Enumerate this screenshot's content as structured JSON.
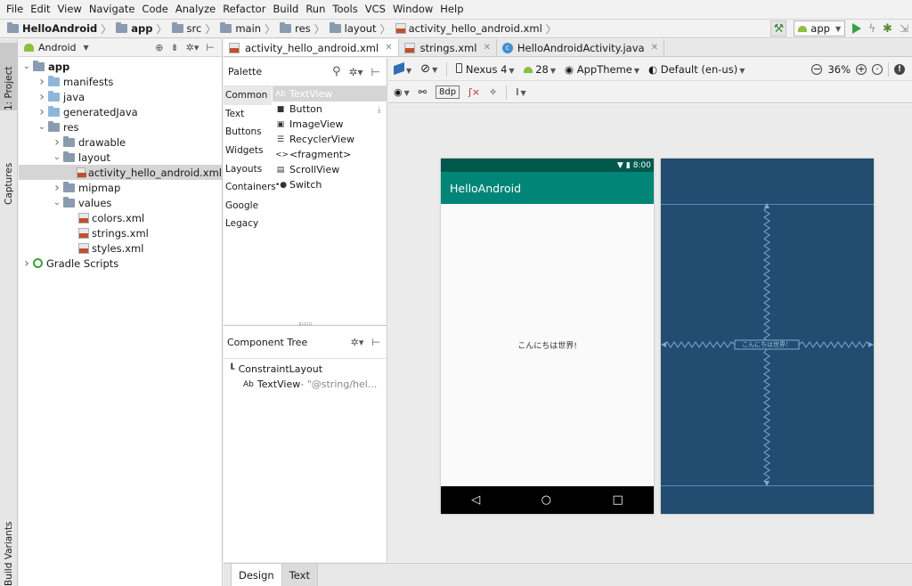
{
  "menu": [
    "File",
    "Edit",
    "View",
    "Navigate",
    "Code",
    "Analyze",
    "Refactor",
    "Build",
    "Run",
    "Tools",
    "VCS",
    "Window",
    "Help"
  ],
  "breadcrumbs": {
    "project": "HelloAndroid",
    "module": "app",
    "src": "src",
    "main": "main",
    "res": "res",
    "layout": "layout",
    "file": "activity_hello_android.xml"
  },
  "run_config": "app",
  "side_tabs": {
    "project": "1: Project",
    "captures": "Captures",
    "build_variants": "Build Variants"
  },
  "project_panel": {
    "view_mode": "Android",
    "tree": [
      {
        "label": "app",
        "indent": 0,
        "arrow": "v",
        "icon": "folder-module",
        "bold": true
      },
      {
        "label": "manifests",
        "indent": 1,
        "arrow": ">",
        "icon": "folder-blue"
      },
      {
        "label": "java",
        "indent": 1,
        "arrow": ">",
        "icon": "folder-blue"
      },
      {
        "label": "generatedJava",
        "indent": 1,
        "arrow": ">",
        "icon": "folder-blue"
      },
      {
        "label": "res",
        "indent": 1,
        "arrow": "v",
        "icon": "folder-res"
      },
      {
        "label": "drawable",
        "indent": 2,
        "arrow": ">",
        "icon": "folder"
      },
      {
        "label": "layout",
        "indent": 2,
        "arrow": "v",
        "icon": "folder"
      },
      {
        "label": "activity_hello_android.xml",
        "indent": 3,
        "arrow": "",
        "icon": "xml-file",
        "selected": true
      },
      {
        "label": "mipmap",
        "indent": 2,
        "arrow": ">",
        "icon": "folder"
      },
      {
        "label": "values",
        "indent": 2,
        "arrow": "v",
        "icon": "folder"
      },
      {
        "label": "colors.xml",
        "indent": 3,
        "arrow": "",
        "icon": "xml-file"
      },
      {
        "label": "strings.xml",
        "indent": 3,
        "arrow": "",
        "icon": "xml-file"
      },
      {
        "label": "styles.xml",
        "indent": 3,
        "arrow": "",
        "icon": "xml-file"
      },
      {
        "label": "Gradle Scripts",
        "indent": 0,
        "arrow": ">",
        "icon": "gradle"
      }
    ]
  },
  "editor_tabs": [
    {
      "label": "activity_hello_android.xml",
      "icon": "xml-file",
      "active": true
    },
    {
      "label": "strings.xml",
      "icon": "xml-file",
      "active": false
    },
    {
      "label": "HelloAndroidActivity.java",
      "icon": "class-file",
      "active": false
    }
  ],
  "palette": {
    "title": "Palette",
    "categories": [
      "Common",
      "Text",
      "Buttons",
      "Widgets",
      "Layouts",
      "Containers",
      "Google",
      "Legacy"
    ],
    "active_category": "Common",
    "items": [
      {
        "icon": "Ab",
        "label": "TextView",
        "selected": true
      },
      {
        "icon": "■",
        "label": "Button"
      },
      {
        "icon": "▣",
        "label": "ImageView"
      },
      {
        "icon": "☰",
        "label": "RecyclerView"
      },
      {
        "icon": "<>",
        "label": "<fragment>"
      },
      {
        "icon": "▤",
        "label": "ScrollView"
      },
      {
        "icon": "•●",
        "label": "Switch"
      }
    ]
  },
  "component_tree": {
    "title": "Component Tree",
    "root": "ConstraintLayout",
    "child_prefix": "Ab",
    "child": "TextView",
    "child_value": "- \"@string/hel..."
  },
  "design_toolbar": {
    "device": "Nexus 4",
    "api": "28",
    "theme": "AppTheme",
    "locale": "Default (en-us)",
    "zoom": "36%",
    "margin": "8dp"
  },
  "device_preview": {
    "time": "8:00",
    "app_title": "HelloAndroid",
    "text": "こんにちは世界!",
    "blueprint_text": "こんにちは世界！"
  },
  "bottom_tabs": [
    "Design",
    "Text"
  ],
  "colors": {
    "status_bar": "#00574b",
    "app_bar": "#008577",
    "blueprint": "#234d70"
  }
}
